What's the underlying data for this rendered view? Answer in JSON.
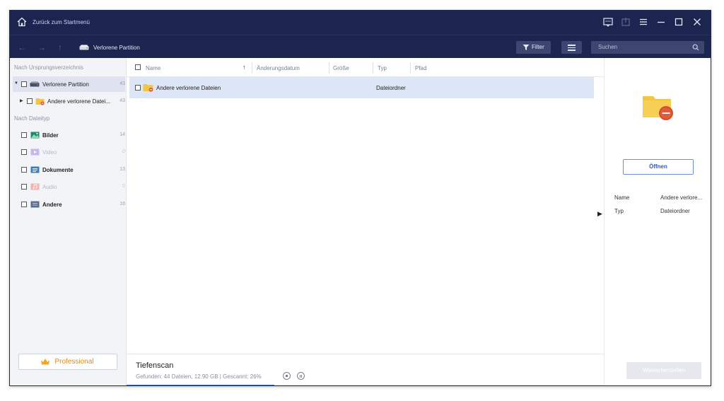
{
  "titlebar": {
    "back_to_start": "Zurück zum Startmenü",
    "icons": [
      "home-icon",
      "feedback-icon",
      "export-icon",
      "menu-icon",
      "minimize-icon",
      "maximize-icon",
      "close-icon"
    ]
  },
  "navbar": {
    "path": "Verlorene Partition",
    "filter_label": "Filter",
    "search_placeholder": "Suchen"
  },
  "sidebar": {
    "section_origin": "Nach Ursprungsverzeichnis",
    "tree": [
      {
        "label": "Verlorene Partition",
        "count": "43"
      },
      {
        "label": "Andere verlorene Datei...",
        "count": "43"
      }
    ],
    "section_type": "Nach Dateityp",
    "types": [
      {
        "label": "Bilder",
        "count": "14",
        "enabled": true
      },
      {
        "label": "Video",
        "count": "0",
        "enabled": false
      },
      {
        "label": "Dokumente",
        "count": "13",
        "enabled": true
      },
      {
        "label": "Audio",
        "count": "0",
        "enabled": false
      },
      {
        "label": "Andere",
        "count": "16",
        "enabled": true
      }
    ],
    "pro_label": "Professional"
  },
  "filelist": {
    "columns": [
      "Name",
      "Änderungsdatum",
      "Größe",
      "Typ",
      "Pfad"
    ],
    "rows": [
      {
        "name": "Andere verlorene Dateien",
        "type": "Dateiordner"
      }
    ]
  },
  "details": {
    "open_label": "Öffnen",
    "name_key": "Name",
    "name_value": "Andere verlore...",
    "type_key": "Typ",
    "type_value": "Dateiordner"
  },
  "status": {
    "title": "Tiefenscan",
    "info": "Gefunden: 44 Dateien, 12.90 GB | Gescannt: 26%",
    "progress": 0.31,
    "restore_label": "Wiederherstellen"
  },
  "colors": {
    "header_bg": "#1c2450",
    "accent": "#3b6fd8",
    "selection": "#dce6f7",
    "pro_orange": "#e58a16"
  }
}
